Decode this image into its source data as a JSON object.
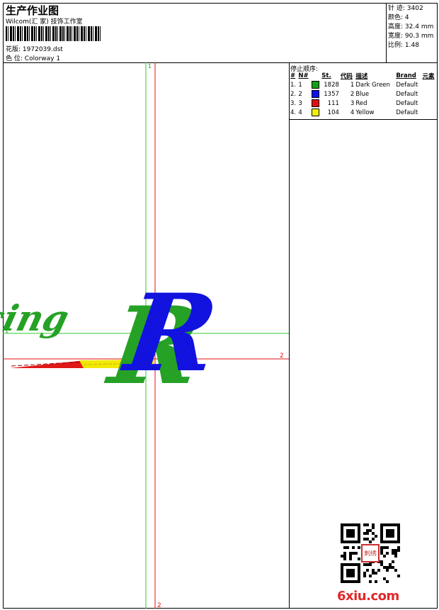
{
  "header": {
    "title": "生产作业图",
    "studio": "Wilcom(汇 家) 技饰工作室",
    "pattern_label": "花版:",
    "pattern_value": "1972039.dst",
    "colorway_label": "色 位:",
    "colorway_value": "Colorway 1"
  },
  "stats": {
    "stitches_label": "针 迹:",
    "stitches": "3402",
    "colors_label": "颜色:",
    "colors": "4",
    "height_label": "高度:",
    "height": "32.4 mm",
    "width_label": "宽度:",
    "width": "90.3 mm",
    "scale_label": "比例:",
    "scale": "1.48"
  },
  "stop_sequence": {
    "title": "停止顺序:",
    "columns": [
      "#",
      "N#",
      "St.",
      "代码",
      "描述",
      "Brand",
      "元素"
    ],
    "rows": [
      {
        "num": "1.",
        "n": "1",
        "color": "#14a014",
        "st": "1828",
        "code": "1",
        "desc": "Dark Green",
        "brand": "Default"
      },
      {
        "num": "2.",
        "n": "2",
        "color": "#1010e8",
        "st": "1357",
        "code": "2",
        "desc": "Blue",
        "brand": "Default"
      },
      {
        "num": "3.",
        "n": "3",
        "color": "#e01010",
        "st": "111",
        "code": "3",
        "desc": "Red",
        "brand": "Default"
      },
      {
        "num": "4.",
        "n": "4",
        "color": "#f0f000",
        "st": "104",
        "code": "4",
        "desc": "Yellow",
        "brand": "Default"
      }
    ]
  },
  "design": {
    "word": "Racing",
    "letter": "R",
    "guide_label_1": "1",
    "guide_label_2": "2",
    "green": "#22a022",
    "blue": "#1010e0",
    "red": "#e01818",
    "yellow": "#f2e800",
    "guide_green": "#2ecc2e",
    "guide_red": "#e01010"
  },
  "footer": {
    "seal_text": "刺绣",
    "watermark": "6xiu.com"
  }
}
